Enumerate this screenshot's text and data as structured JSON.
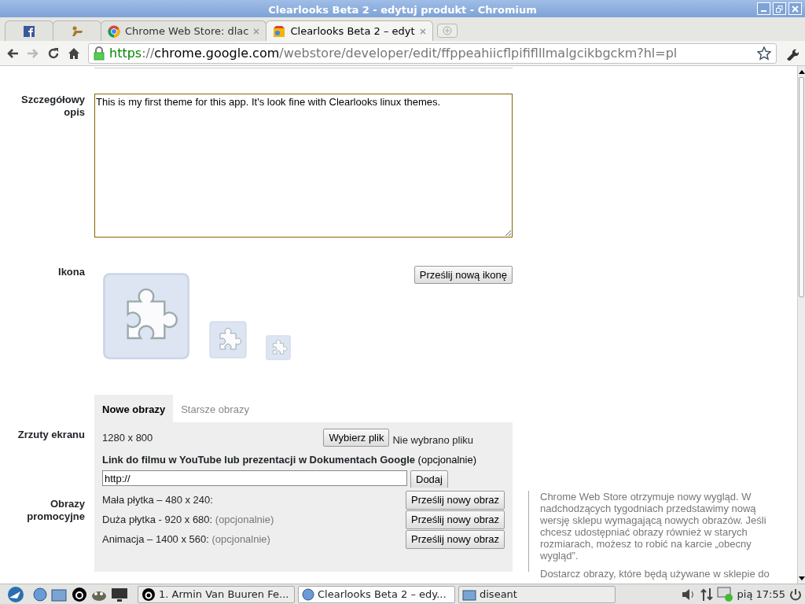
{
  "window": {
    "title": "Clearlooks Beta 2 - edytuj produkt - Chromium"
  },
  "tabs": [
    {
      "kind": "facebook",
      "selected": false
    },
    {
      "kind": "tool",
      "selected": false
    },
    {
      "kind": "store",
      "label": "Chrome Web Store: dlac",
      "selected": false
    },
    {
      "kind": "theme",
      "label": "Clearlooks Beta 2 – edyt",
      "selected": true
    }
  ],
  "address_bar": {
    "parts": [
      {
        "kind": "secure",
        "text": "https"
      },
      {
        "kind": "dim",
        "text": "://"
      },
      {
        "kind": "host",
        "text": "chrome.google.com"
      },
      {
        "kind": "dim",
        "text": "/webstore/developer/edit/ffppeahiicflpififlllmalgcikbgckm?hl=pl"
      }
    ]
  },
  "description": {
    "label": "Szczegółowy opis",
    "value": "This is my first theme for this app. It's look fine with Clearlooks linux themes."
  },
  "icon_section": {
    "label": "Ikona",
    "button": "Prześlij nową ikonę"
  },
  "image_tabs": [
    {
      "label": "Nowe obrazy",
      "selected": true
    },
    {
      "label": "Starsze obrazy",
      "selected": false
    }
  ],
  "screenshots": {
    "label": "Zrzuty ekranu",
    "size": "1280 x 800",
    "file_button": "Wybierz plik",
    "file_status": "Nie wybrano pliku",
    "video_label": "Link do filmu w YouTube lub prezentacji w Dokumentach Google",
    "video_optional": "(opcjonalnie)",
    "video_value": "http://",
    "add_button": "Dodaj"
  },
  "promo": {
    "label": "Obrazy promocyjne",
    "rows": [
      {
        "text": "Mała płytka – 480 x 240:",
        "button": "Prześlij nowy obraz"
      },
      {
        "text": "Duża płytka - 920 x 680:",
        "optional": "(opcjonalnie)",
        "button": "Prześlij nowy obraz"
      },
      {
        "text": "Animacja – 1400 x 560:",
        "optional": "(opcjonalnie)",
        "button": "Prześlij nowy obraz"
      }
    ]
  },
  "note": [
    "Chrome Web Store otrzymuje nowy wygląd. W nadchodzących tygodniach przedstawimy nową wersję sklepu wymagającą nowych obrazów. Jeśli chcesz udostępniać obrazy również w starych rozmiarach, możesz to robić na karcie „obecny wygląd”.",
    "Dostarcz obrazy, które będą używane w sklepie do"
  ],
  "taskbar": {
    "tasks": [
      {
        "kind": "music",
        "label": "1. Armin Van Buuren Fe...",
        "selected": false
      },
      {
        "kind": "browser",
        "label": "Clearlooks Beta 2 – edy...",
        "selected": true
      },
      {
        "kind": "folder",
        "label": "diseant",
        "selected": false
      }
    ],
    "clock": "pią 17:55"
  }
}
